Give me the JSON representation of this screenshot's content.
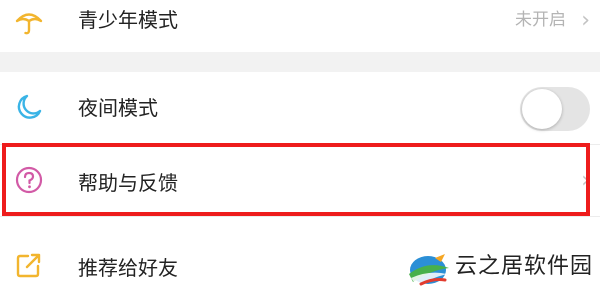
{
  "settings": {
    "items": [
      {
        "label": "青少年模式",
        "icon": "umbrella-icon",
        "status": "未开启"
      },
      {
        "label": "夜间模式",
        "icon": "moon-icon",
        "toggle_on": false
      },
      {
        "label": "帮助与反馈",
        "icon": "question-circle-icon"
      },
      {
        "label": "推荐给好友",
        "icon": "share-icon"
      }
    ],
    "chevron": "›"
  },
  "watermark": {
    "text": "云之居软件园"
  },
  "colors": {
    "highlight": "#ee1c1c",
    "umbrella_icon": "#f2b52e",
    "moon_icon": "#3ab4e6",
    "question_icon": "#d25aa6",
    "share_icon": "#f2b52e",
    "toggle_track": "#e4e4e4",
    "section_gap": "#f2f2f2"
  }
}
